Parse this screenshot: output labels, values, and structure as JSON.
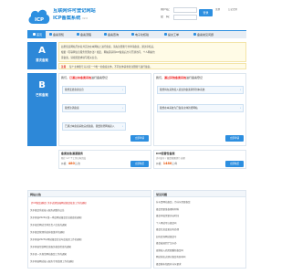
{
  "brand": {
    "title": "互联网许可登记网站",
    "subtitle": "ICP备案系统",
    "version": "V2.0",
    "logo_text": "ICP",
    "color": "#1a85d6"
  },
  "login": {
    "user_label": "用户名：",
    "pass_label": "密　码：",
    "login_button": "登录",
    "register_link": "注册",
    "forgot_link": "忘记密码"
  },
  "nav": {
    "items": [
      {
        "label": "首页",
        "icon": "home-icon"
      },
      {
        "label": "备案须知",
        "icon": "doc-icon"
      },
      {
        "label": "备案流程",
        "icon": "flow-icon"
      },
      {
        "label": "备案查询",
        "icon": "search-icon"
      },
      {
        "label": "电子化核验",
        "icon": "check-icon"
      },
      {
        "label": "提交工单",
        "icon": "ticket-icon"
      },
      {
        "label": "备案常见问题",
        "icon": "question-icon"
      }
    ]
  },
  "section_a": {
    "letter": "A",
    "title": "首次备案",
    "desc_lines": [
      "如果您是网站开办者并首次在本网站上进行备案，请先注册账号并申请备案，通过审核后，",
      "根据《互联网信息服务管理办法》规定，网站需获得ICP备案后方可开通访问，个人网站也",
      "需备案，请按照要求填写相关信息。"
    ],
    "notice_tag": "注意",
    "notice_text": "每个主体账号只对应一个唯一的备案主体，不同主体请重新注册账号进行备案。"
  },
  "section_b": {
    "letter": "B",
    "title": "已有备案",
    "left_question_pre": "我们，",
    "left_question_hl": "已通过本备案系统",
    "left_question_post": "进行备案登记",
    "right_question_pre": "我们，",
    "right_question_hl": "通过其他备案系统",
    "right_question_post": "进行备案登记",
    "left_options": [
      "我想变更备案信息",
      "我想注销备案",
      "已通过本备案系统完成备案，我要新增网站接入"
    ],
    "right_options": [
      "我想将在其他接入商处的备案转移到本系统",
      "我想在本系统为已备案主体新增网站"
    ],
    "apply_button": "立即申请"
  },
  "prices": [
    {
      "title": "备案加急通道服务",
      "desc": "预计 1-7 个工作日内完成",
      "label": "价格：",
      "value": "480",
      "unit": "元/次",
      "button": "立即购买"
    },
    {
      "title": "ICP经营性备案",
      "desc": "许可证号 / 备案管理部门 办理",
      "label": "价格：",
      "value": "1480",
      "unit": "元/年",
      "button": "立即购买"
    }
  ],
  "lists": {
    "left_title": "网站公告",
    "right_title": "常见问题",
    "left_items": [
      "【ICP备案通知】关于近期加强网站备案核查工作的通知",
      "关于备案系统接入服务调整的公告",
      "关于开展2024年第一季度网站备案信息抽查的通知",
      "关于规范网站主体负责人信息的通知",
      "关于备案管理系统升级维护的通知",
      "关于开展2023年网站备案信息年度核验工作的通知",
      "关于开展互联网信息服务备案检查的通知",
      "关于进一步规范网站备案工作的通知",
      "关于开展网站接入服务专项清理工作的通知"
    ],
    "right_items": [
      "什么是网站备案，为什么需要备案",
      "备案需要准备哪些材料",
      "备案审核需要多长时间",
      "个人网站可以备案吗",
      "备案信息变更如何办理",
      "如何查询网站备案号",
      "备案被退回了怎么办",
      "更换接入商需要重新备案吗",
      "网站域名过期对备案有影响吗",
      "备案幕布拍照有什么要求"
    ]
  }
}
